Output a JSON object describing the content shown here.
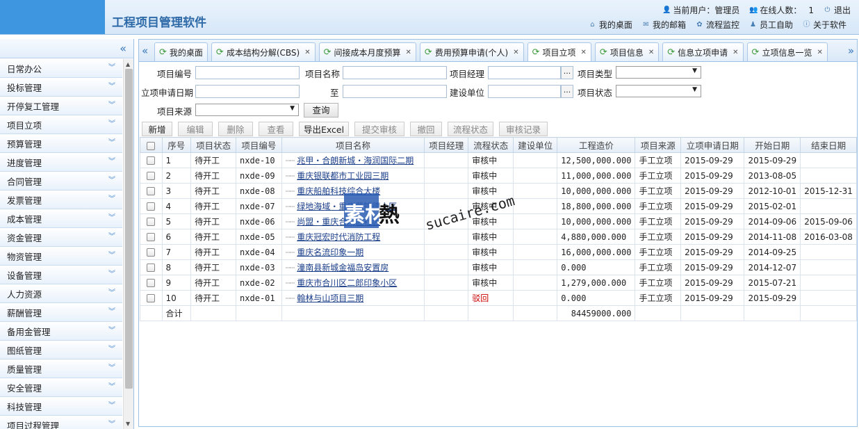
{
  "header": {
    "title": "工程项目管理软件",
    "current_user_label": "当前用户：管理员",
    "online_label": "在线人数：",
    "online_count": "1",
    "logout": "退出",
    "nav": [
      "我的桌面",
      "我的邮箱",
      "流程监控",
      "员工自助",
      "关于软件"
    ]
  },
  "sidebar": {
    "collapse": "«",
    "items": [
      "日常办公",
      "投标管理",
      "开停复工管理",
      "项目立项",
      "预算管理",
      "进度管理",
      "合同管理",
      "发票管理",
      "成本管理",
      "资金管理",
      "物资管理",
      "设备管理",
      "人力资源",
      "薪酬管理",
      "备用金管理",
      "图纸管理",
      "质量管理",
      "安全管理",
      "科技管理",
      "项目过程管理"
    ]
  },
  "tabs": [
    {
      "label": "我的桌面"
    },
    {
      "label": "成本结构分解(CBS)"
    },
    {
      "label": "间接成本月度预算"
    },
    {
      "label": "费用预算申请(个人)"
    },
    {
      "label": "项目立项"
    },
    {
      "label": "项目信息"
    },
    {
      "label": "信息立项申请"
    },
    {
      "label": "立项信息一览"
    }
  ],
  "search": {
    "project_no": "项目编号",
    "project_name": "项目名称",
    "project_manager": "项目经理",
    "project_type": "项目类型",
    "apply_date": "立项申请日期",
    "to": "至",
    "build_unit": "建设单位",
    "project_status": "项目状态",
    "project_source": "项目来源",
    "query": "查询",
    "dots": "..."
  },
  "toolbar": [
    "新增",
    "编辑",
    "删除",
    "查看",
    "导出Excel",
    "提交审核",
    "撤回",
    "流程状态",
    "审核记录"
  ],
  "table": {
    "headers": [
      "",
      "序号",
      "项目状态",
      "项目编号",
      "项目名称",
      "项目经理",
      "流程状态",
      "建设单位",
      "工程造价",
      "项目来源",
      "立项申请日期",
      "开始日期",
      "结束日期"
    ],
    "rows": [
      {
        "no": "1",
        "status": "待开工",
        "code": "nxde-10",
        "name": "兆甲・合朗新城・海润国际二期",
        "manager": "",
        "flow": "审核中",
        "unit": "",
        "cost": "12,500,000.000",
        "source": "手工立项",
        "apply": "2015-09-29",
        "start": "2015-09-29",
        "end": ""
      },
      {
        "no": "2",
        "status": "待开工",
        "code": "nxde-09",
        "name": "重庆银联都市工业园三期",
        "manager": "",
        "flow": "审核中",
        "unit": "",
        "cost": "11,000,000.000",
        "source": "手工立项",
        "apply": "2015-09-29",
        "start": "2013-08-05",
        "end": ""
      },
      {
        "no": "3",
        "status": "待开工",
        "code": "nxde-08",
        "name": "重庆船舶科技综合大楼",
        "manager": "",
        "flow": "审核中",
        "unit": "",
        "cost": "10,000,000.000",
        "source": "手工立项",
        "apply": "2015-09-29",
        "start": "2012-10-01",
        "end": "2015-12-31"
      },
      {
        "no": "4",
        "status": "待开工",
        "code": "nxde-07",
        "name": "绿地海域・重庆荣锦德小区",
        "manager": "",
        "flow": "审核中",
        "unit": "",
        "cost": "18,800,000.000",
        "source": "手工立项",
        "apply": "2015-09-29",
        "start": "2015-02-01",
        "end": ""
      },
      {
        "no": "5",
        "status": "待开工",
        "code": "nxde-06",
        "name": "尚盟・重庆合川区社区",
        "manager": "",
        "flow": "审核中",
        "unit": "",
        "cost": "10,000,000.000",
        "source": "手工立项",
        "apply": "2015-09-29",
        "start": "2014-09-06",
        "end": "2015-09-06"
      },
      {
        "no": "6",
        "status": "待开工",
        "code": "nxde-05",
        "name": "重庆冠宏时代消防工程",
        "manager": "",
        "flow": "审核中",
        "unit": "",
        "cost": "4,880,000.000",
        "source": "手工立项",
        "apply": "2015-09-29",
        "start": "2014-11-08",
        "end": "2016-03-08"
      },
      {
        "no": "7",
        "status": "待开工",
        "code": "nxde-04",
        "name": "重庆名流印象一期",
        "manager": "",
        "flow": "审核中",
        "unit": "",
        "cost": "16,000,000.000",
        "source": "手工立项",
        "apply": "2015-09-29",
        "start": "2014-09-25",
        "end": ""
      },
      {
        "no": "8",
        "status": "待开工",
        "code": "nxde-03",
        "name": "潼南县新城金福岛安置房",
        "manager": "",
        "flow": "审核中",
        "unit": "",
        "cost": "0.000",
        "source": "手工立项",
        "apply": "2015-09-29",
        "start": "2014-12-07",
        "end": ""
      },
      {
        "no": "9",
        "status": "待开工",
        "code": "nxde-02",
        "name": "重庆市合川区二郎印象小区",
        "manager": "",
        "flow": "审核中",
        "unit": "",
        "cost": "1,279,000.000",
        "source": "手工立项",
        "apply": "2015-09-29",
        "start": "2015-07-21",
        "end": ""
      },
      {
        "no": "10",
        "status": "待开工",
        "code": "nxde-01",
        "name": "翰林与山项目三期",
        "manager": "",
        "flow": "驳回",
        "unit": "",
        "cost": "0.000",
        "source": "手工立项",
        "apply": "2015-09-29",
        "start": "2015-09-29",
        "end": ""
      }
    ],
    "total_label": "合计",
    "total_cost": "84459000.000"
  },
  "watermark": {
    "cn": "素材",
    "cn2": "熱",
    "url": "sucaire.com"
  },
  "colors": {
    "accent": "#3e95e0",
    "link": "#1a3e8a",
    "reject": "#cc0000"
  }
}
